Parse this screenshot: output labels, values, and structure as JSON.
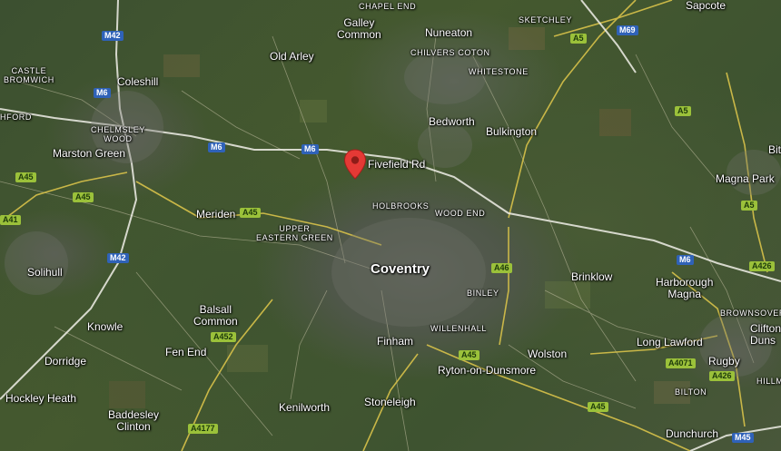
{
  "map": {
    "pin": {
      "name": "location-pin",
      "color": "#e53935"
    },
    "labels": [
      {
        "id": "chapel-end",
        "text": "CHAPEL END",
        "kind": "area"
      },
      {
        "id": "galley-common",
        "text": "Galley\nCommon",
        "kind": "place"
      },
      {
        "id": "nuneaton",
        "text": "Nuneaton",
        "kind": "place"
      },
      {
        "id": "sketchley",
        "text": "SKETCHLEY",
        "kind": "area"
      },
      {
        "id": "sapcote",
        "text": "Sapcote",
        "kind": "place"
      },
      {
        "id": "old-arley",
        "text": "Old Arley",
        "kind": "place"
      },
      {
        "id": "chilvers-coton",
        "text": "CHILVERS COTON",
        "kind": "area"
      },
      {
        "id": "whitestone",
        "text": "WHITESTONE",
        "kind": "area"
      },
      {
        "id": "castle-bromwich",
        "text": "CASTLE\nBROMWICH",
        "kind": "area"
      },
      {
        "id": "coleshill",
        "text": "Coleshill",
        "kind": "place"
      },
      {
        "id": "ford",
        "text": "HFORD",
        "kind": "area"
      },
      {
        "id": "chelmsley-wood",
        "text": "CHELMSLEY\nWOOD",
        "kind": "area"
      },
      {
        "id": "bedworth",
        "text": "Bedworth",
        "kind": "place"
      },
      {
        "id": "bulkington",
        "text": "Bulkington",
        "kind": "place"
      },
      {
        "id": "marston-green",
        "text": "Marston Green",
        "kind": "place"
      },
      {
        "id": "fivefield-rd",
        "text": "Fivefield Rd",
        "kind": "pin-label"
      },
      {
        "id": "magna-park",
        "text": "Magna Park",
        "kind": "place"
      },
      {
        "id": "bit",
        "text": "Bit",
        "kind": "place"
      },
      {
        "id": "holbrooks",
        "text": "HOLBROOKS",
        "kind": "area"
      },
      {
        "id": "wood-end",
        "text": "WOOD END",
        "kind": "area"
      },
      {
        "id": "meriden",
        "text": "Meriden",
        "kind": "place"
      },
      {
        "id": "upper-eastern-green",
        "text": "UPPER\nEASTERN GREEN",
        "kind": "area"
      },
      {
        "id": "coventry",
        "text": "Coventry",
        "kind": "city"
      },
      {
        "id": "solihull",
        "text": "Solihull",
        "kind": "place"
      },
      {
        "id": "brinklow",
        "text": "Brinklow",
        "kind": "place"
      },
      {
        "id": "harborough-magna",
        "text": "Harborough\nMagna",
        "kind": "place"
      },
      {
        "id": "binley",
        "text": "BINLEY",
        "kind": "area"
      },
      {
        "id": "balsall-common",
        "text": "Balsall\nCommon",
        "kind": "place"
      },
      {
        "id": "knowle",
        "text": "Knowle",
        "kind": "place"
      },
      {
        "id": "willenhall",
        "text": "WILLENHALL",
        "kind": "area"
      },
      {
        "id": "brownsover",
        "text": "BROWNSOVER",
        "kind": "area"
      },
      {
        "id": "clifton-dunsmore",
        "text": "Clifton\nDuns",
        "kind": "place"
      },
      {
        "id": "fen-end",
        "text": "Fen End",
        "kind": "place"
      },
      {
        "id": "finham",
        "text": "Finham",
        "kind": "place"
      },
      {
        "id": "wolston",
        "text": "Wolston",
        "kind": "place"
      },
      {
        "id": "long-lawford",
        "text": "Long Lawford",
        "kind": "place"
      },
      {
        "id": "dorridge",
        "text": "Dorridge",
        "kind": "place"
      },
      {
        "id": "ryton",
        "text": "Ryton-on-Dunsmore",
        "kind": "place"
      },
      {
        "id": "rugby",
        "text": "Rugby",
        "kind": "place"
      },
      {
        "id": "dunsmore",
        "text": "Duns",
        "kind": "place"
      },
      {
        "id": "hillmorton",
        "text": "HILLM",
        "kind": "area"
      },
      {
        "id": "hockley-heath",
        "text": "Hockley Heath",
        "kind": "place"
      },
      {
        "id": "stoneleigh",
        "text": "Stoneleigh",
        "kind": "place"
      },
      {
        "id": "bilton",
        "text": "BILTON",
        "kind": "area"
      },
      {
        "id": "baddesley-clinton",
        "text": "Baddesley\nClinton",
        "kind": "place"
      },
      {
        "id": "kenilworth",
        "text": "Kenilworth",
        "kind": "place"
      },
      {
        "id": "dunchurch",
        "text": "Dunchurch",
        "kind": "place"
      }
    ],
    "shields": [
      {
        "id": "m42-top",
        "text": "M42",
        "type": "motorway"
      },
      {
        "id": "m69",
        "text": "M69",
        "type": "motorway"
      },
      {
        "id": "a5-top",
        "text": "A5",
        "type": "primary"
      },
      {
        "id": "m6-left",
        "text": "M6",
        "type": "motorway"
      },
      {
        "id": "a5-right",
        "text": "A5",
        "type": "primary"
      },
      {
        "id": "m6-mid-left",
        "text": "M6",
        "type": "motorway"
      },
      {
        "id": "m6-mid",
        "text": "M6",
        "type": "motorway"
      },
      {
        "id": "a45-left",
        "text": "A45",
        "type": "primary"
      },
      {
        "id": "a45-left2",
        "text": "A45",
        "type": "primary"
      },
      {
        "id": "a5-far-right",
        "text": "A5",
        "type": "primary"
      },
      {
        "id": "a41",
        "text": "A41",
        "type": "primary"
      },
      {
        "id": "a45-meriden",
        "text": "A45",
        "type": "primary"
      },
      {
        "id": "m42-mid",
        "text": "M42",
        "type": "motorway"
      },
      {
        "id": "a46",
        "text": "A46",
        "type": "primary"
      },
      {
        "id": "m6-right",
        "text": "M6",
        "type": "motorway"
      },
      {
        "id": "a426-top",
        "text": "A426",
        "type": "primary"
      },
      {
        "id": "a452",
        "text": "A452",
        "type": "primary"
      },
      {
        "id": "a45-ryton",
        "text": "A45",
        "type": "primary"
      },
      {
        "id": "a4071",
        "text": "A4071",
        "type": "primary"
      },
      {
        "id": "a426-bottom",
        "text": "A426",
        "type": "primary"
      },
      {
        "id": "a45-bottom",
        "text": "A45",
        "type": "primary"
      },
      {
        "id": "a4177",
        "text": "A4177",
        "type": "primary"
      },
      {
        "id": "m45",
        "text": "M45",
        "type": "motorway"
      }
    ]
  }
}
